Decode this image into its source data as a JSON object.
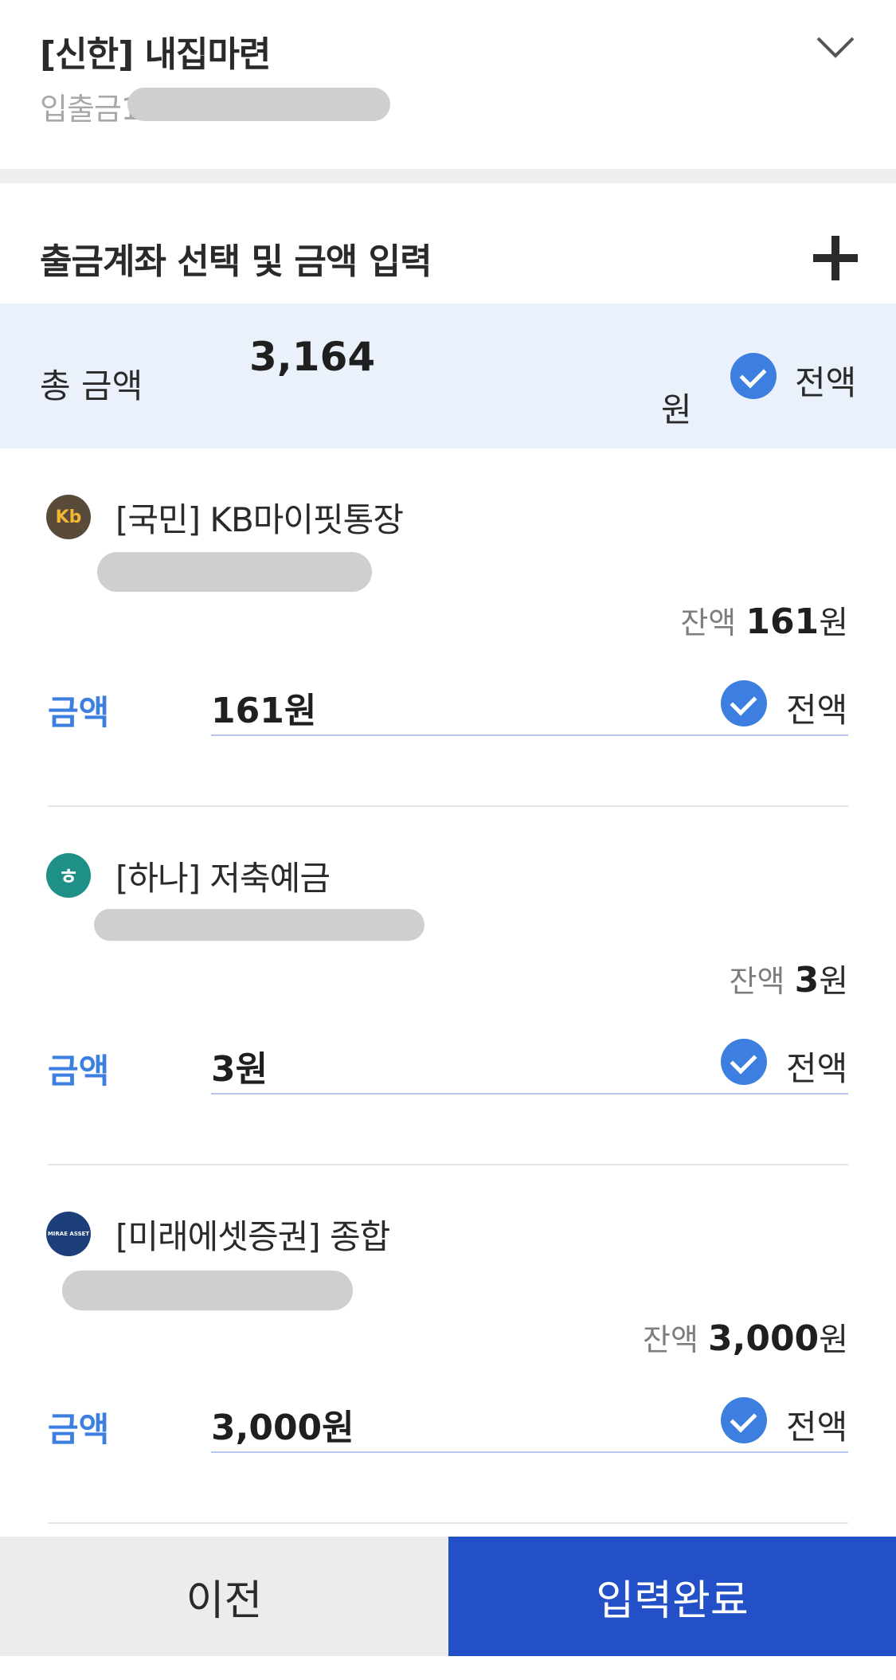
{
  "header": {
    "account_name": "[신한] 내집마련",
    "account_sub": "입출금110-"
  },
  "section": {
    "title": "출금계좌 선택 및 금액 입력"
  },
  "total": {
    "label": "총 금액",
    "amount": "3,164",
    "unit": "원",
    "all_label": "전액"
  },
  "accounts": [
    {
      "bank_name": "[국민] KB마이핏통장",
      "balance_label": "잔액",
      "balance_value": "161",
      "balance_unit": "원",
      "amount_label": "금액",
      "amount_value": "161원",
      "all_label": "전액",
      "logo_color": "#5a4a3a",
      "logo_text": "Kb"
    },
    {
      "bank_name": "[하나] 저축예금",
      "balance_label": "잔액",
      "balance_value": "3",
      "balance_unit": "원",
      "amount_label": "금액",
      "amount_value": "3원",
      "all_label": "전액",
      "logo_color": "#1f9088",
      "logo_text": "ㅎ"
    },
    {
      "bank_name": "[미래에셋증권] 종합",
      "balance_label": "잔액",
      "balance_value": "3,000",
      "balance_unit": "원",
      "amount_label": "금액",
      "amount_value": "3,000원",
      "all_label": "전액",
      "logo_color": "#1c3f7a",
      "logo_text": "MIRAE ASSET"
    }
  ],
  "buttons": {
    "prev": "이전",
    "done": "입력완료"
  },
  "colors": {
    "accent": "#3d7fe0",
    "primary_button": "#2350c6",
    "total_bg": "#eaf1fb"
  }
}
